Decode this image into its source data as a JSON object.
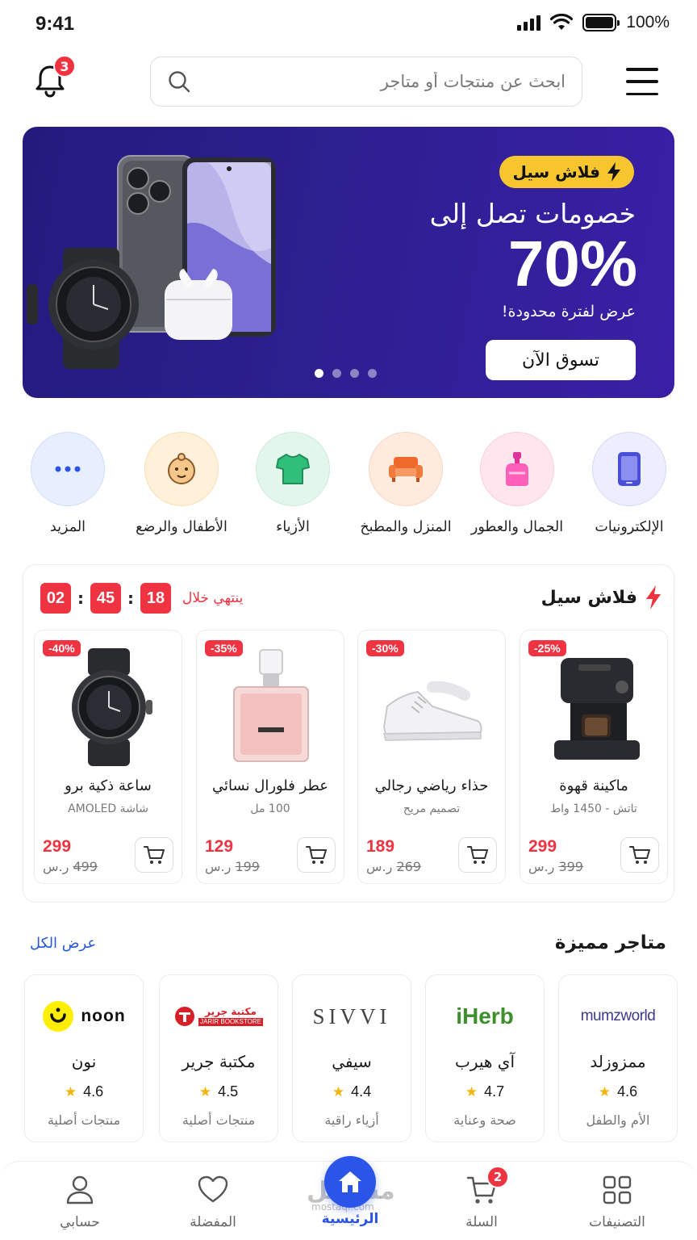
{
  "status_bar": {
    "time": "9:41",
    "battery": "100%"
  },
  "header": {
    "notifications_count": "3",
    "search_placeholder": "ابحث عن منتجات أو متاجر"
  },
  "banner": {
    "pill": "فلاش سيل",
    "line1": "خصومات تصل إلى",
    "percent": "70%",
    "subtitle": "عرض لفترة محدودة!",
    "button": "تسوق الآن",
    "slides": 4,
    "active_slide": 1
  },
  "categories": [
    {
      "label": "الإلكترونيات",
      "icon": "phone-icon",
      "bg": "#eceeff"
    },
    {
      "label": "الجمال والعطور",
      "icon": "perfume-icon",
      "bg": "#ffe5ee"
    },
    {
      "label": "المنزل والمطبخ",
      "icon": "sofa-icon",
      "bg": "#ffeade"
    },
    {
      "label": "الأزياء",
      "icon": "tshirt-icon",
      "bg": "#e2f6ec"
    },
    {
      "label": "الأطفال والرضع",
      "icon": "baby-icon",
      "bg": "#fff0d9"
    },
    {
      "label": "المزيد",
      "icon": "more-icon",
      "bg": "#e7efff"
    }
  ],
  "flash_sale": {
    "title": "فلاش سيل",
    "ends_in": "ينتهي خلال",
    "timer": {
      "hours": "18",
      "minutes": "45",
      "seconds": "02"
    },
    "products": [
      {
        "name": "ماكينة قهوة",
        "desc": "تاتش - 1450 واط",
        "discount": "-25%",
        "price": "299",
        "old_price": "399",
        "currency": "ر.س"
      },
      {
        "name": "حذاء رياضي رجالي",
        "desc": "تصميم مريح",
        "discount": "-30%",
        "price": "189",
        "old_price": "269",
        "currency": "ر.س"
      },
      {
        "name": "عطر فلورال نسائي",
        "desc": "100 مل",
        "discount": "-35%",
        "price": "129",
        "old_price": "199",
        "currency": "ر.س"
      },
      {
        "name": "ساعة ذكية برو",
        "desc": "شاشة AMOLED",
        "discount": "-40%",
        "price": "299",
        "old_price": "499",
        "currency": "ر.س"
      }
    ]
  },
  "stores": {
    "title": "متاجر مميزة",
    "view_all": "عرض الكل",
    "items": [
      {
        "logo": "mumzworld",
        "name": "ممزوزلد",
        "rating": "4.6",
        "category": "الأم والطفل"
      },
      {
        "logo": "iHerb",
        "name": "آي هيرب",
        "rating": "4.7",
        "category": "صحة وعناية"
      },
      {
        "logo": "SIVVI",
        "name": "سيفي",
        "rating": "4.4",
        "category": "أزياء راقية"
      },
      {
        "logo": "مكتبة جرير",
        "logo_sub": "JARIR BOOKSTORE",
        "name": "مكتبة جرير",
        "rating": "4.5",
        "category": "منتجات أصلية"
      },
      {
        "logo": "noon",
        "name": "نون",
        "rating": "4.6",
        "category": "منتجات أصلية"
      }
    ]
  },
  "bottom_nav": {
    "categories": "التصنيفات",
    "cart": "السلة",
    "cart_count": "2",
    "home": "الرئيسية",
    "favorites": "المفضلة",
    "account": "حسابي"
  },
  "watermark": {
    "text": "مستقل",
    "sub": "mostaql.com"
  },
  "colors": {
    "primary": "#2b55e8",
    "sale_red": "#ef3340",
    "banner": "#2c1f8f",
    "pill_yellow": "#f7c62f"
  }
}
